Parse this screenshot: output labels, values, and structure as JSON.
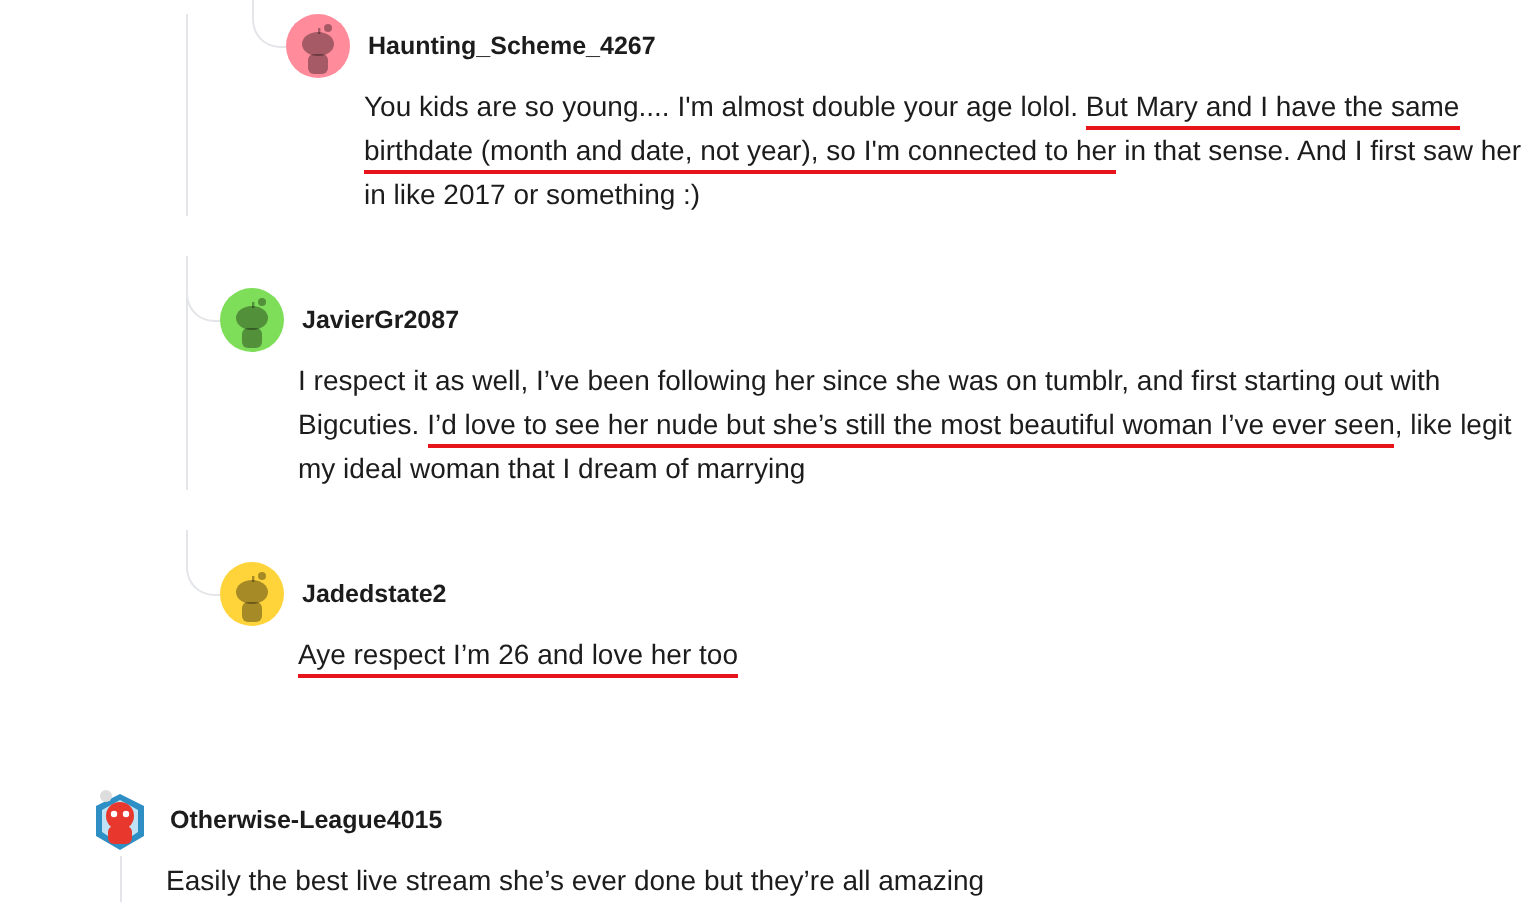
{
  "comments": [
    {
      "children": [
        {
          "children": [
            {
              "children": [
                {
                  "author": "Haunting_Scheme_4267",
                  "kind": "default",
                  "color": "#ff8b9b",
                  "has_replies": false,
                  "body": [
                    {
                      "text": "You kids are so young.... I'm almost double your age lolol. ",
                      "underlined": false
                    },
                    {
                      "text": "But Mary and I have the same birthdate (month and date, not year), so I'm connected to her",
                      "underlined": true
                    },
                    {
                      "text": " in that sense. And I first saw her in like 2017 or something :)",
                      "underlined": false
                    }
                  ]
                }
              ]
            },
            {
              "author": "JavierGr2087",
              "kind": "default",
              "color": "#7ede5a",
              "has_replies": false,
              "body": [
                {
                  "text": "I respect it as well, I’ve been following her since she was on tumblr, and first starting out with Bigcuties. ",
                  "underlined": false
                },
                {
                  "text": "I’d love to see her nude but she’s still the most beautiful woman I’ve ever seen",
                  "underlined": true
                },
                {
                  "text": ", like legit my ideal woman that I dream of marrying",
                  "underlined": false
                }
              ]
            },
            {
              "author": "Jadedstate2",
              "kind": "default",
              "color": "#ffd43a",
              "has_replies": false,
              "body": [
                {
                  "text": "Aye respect I’m 26 and love her too",
                  "underlined": true
                }
              ]
            }
          ]
        }
      ]
    },
    {
      "author": "Otherwise-League4015",
      "kind": "custom",
      "color": "#e8372c",
      "has_replies": true,
      "body": [
        {
          "text": "Easily the best live stream she’s ever done but they’re all amazing",
          "underlined": false
        }
      ]
    }
  ]
}
